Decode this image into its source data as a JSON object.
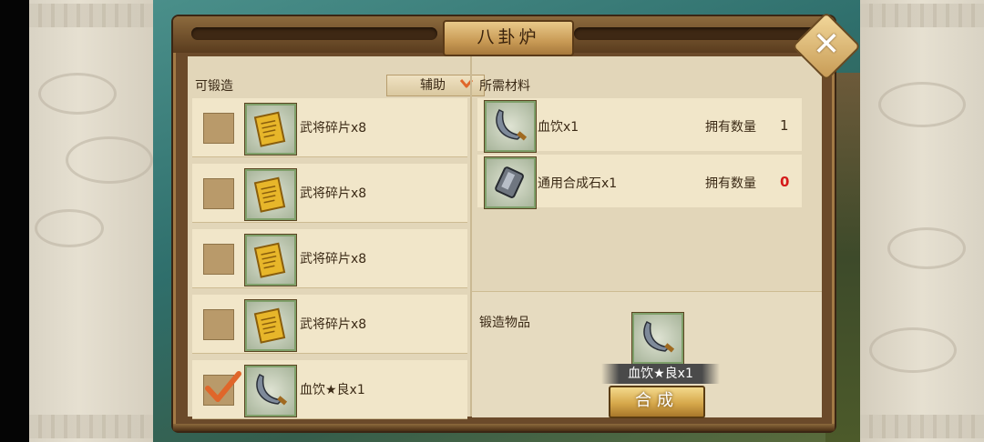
{
  "title": "八卦炉",
  "close_icon": "close-x-icon",
  "left": {
    "section_label": "可锻造",
    "filter": {
      "label": "辅助",
      "icon": "chevron-down-icon",
      "accent": "#e0662a"
    },
    "items": [
      {
        "name": "武将碎片x8",
        "checked": false,
        "icon": "scroll-fragment-icon"
      },
      {
        "name": "武将碎片x8",
        "checked": false,
        "icon": "scroll-fragment-icon"
      },
      {
        "name": "武将碎片x8",
        "checked": false,
        "icon": "scroll-fragment-icon"
      },
      {
        "name": "武将碎片x8",
        "checked": false,
        "icon": "scroll-fragment-icon"
      },
      {
        "name": "血饮★良x1",
        "checked": true,
        "icon": "curved-blade-icon"
      }
    ]
  },
  "materials": {
    "section_label": "所需材料",
    "rows": [
      {
        "name": "血饮x1",
        "own_label": "拥有数量",
        "count": "1",
        "icon": "curved-blade-icon"
      },
      {
        "name": "通用合成石x1",
        "own_label": "拥有数量",
        "count": "0",
        "icon": "synthesis-stone-icon",
        "count_color": "#d51a1a"
      }
    ]
  },
  "forge": {
    "section_label": "锻造物品",
    "result_name": "血饮★良x1",
    "result_icon": "curved-blade-icon",
    "button_label": "合成"
  }
}
